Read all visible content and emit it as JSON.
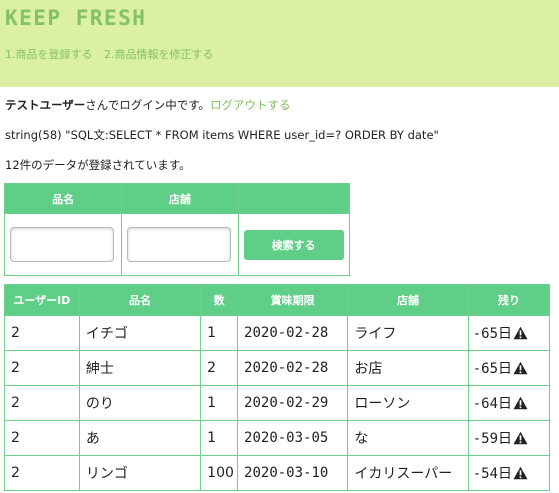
{
  "brand": "KEEP FRESH",
  "nav": {
    "register": "1.商品を登録する",
    "edit": "2.商品情報を修正する"
  },
  "status": {
    "user": "テストユーザー",
    "suffix": "さんでログイン中です。",
    "logout": "ログアウトする"
  },
  "debug": "string(58) \"SQL文:SELECT * FROM items WHERE user_id=? ORDER BY date\"",
  "count_text": "12件のデータが登録されています。",
  "search": {
    "col_name": "品名",
    "col_store": "店舗",
    "name_value": "",
    "store_value": "",
    "button": "検索する"
  },
  "table": {
    "headers": [
      "ユーザーID",
      "品名",
      "数",
      "賞味期限",
      "店舗",
      "残り"
    ],
    "rows": [
      {
        "user_id": "2",
        "name": "イチゴ",
        "qty": "1",
        "date": "2020-02-28",
        "store": "ライフ",
        "remain": "-65日"
      },
      {
        "user_id": "2",
        "name": "紳士",
        "qty": "2",
        "date": "2020-02-28",
        "store": "お店",
        "remain": "-65日"
      },
      {
        "user_id": "2",
        "name": "のり",
        "qty": "1",
        "date": "2020-02-29",
        "store": "ローソン",
        "remain": "-64日"
      },
      {
        "user_id": "2",
        "name": "あ",
        "qty": "1",
        "date": "2020-03-05",
        "store": "な",
        "remain": "-59日"
      },
      {
        "user_id": "2",
        "name": "リンゴ",
        "qty": "100",
        "date": "2020-03-10",
        "store": "イカリスーパー",
        "remain": "-54日"
      }
    ]
  },
  "colors": {
    "header_bg": "#dbf0a3",
    "brand": "#85c263",
    "accent": "#5fce86",
    "link": "#7fbf5e"
  },
  "icons": {
    "warning": "warning-triangle-icon"
  }
}
